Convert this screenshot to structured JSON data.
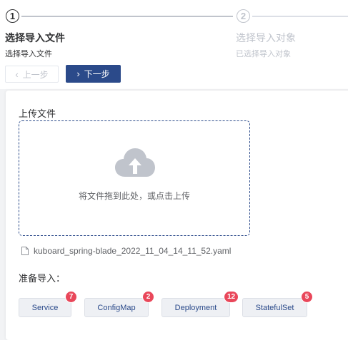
{
  "steps": [
    {
      "number": "1",
      "title": "选择导入文件",
      "description": "选择导入文件"
    },
    {
      "number": "2",
      "title": "选择导入对象",
      "description": "已选择导入对象"
    }
  ],
  "buttons": {
    "prev_label": "上一步",
    "next_label": "下一步"
  },
  "upload": {
    "label": "上传文件",
    "dropzone_text": "将文件拖到此处，或点击上传",
    "file_name": "kuboard_spring-blade_2022_11_04_14_11_52.yaml"
  },
  "prepare": {
    "label": "准备导入：",
    "items": [
      {
        "name": "Service",
        "count": "7"
      },
      {
        "name": "ConfigMap",
        "count": "2"
      },
      {
        "name": "Deployment",
        "count": "12"
      },
      {
        "name": "StatefulSet",
        "count": "5"
      }
    ]
  },
  "colors": {
    "accent": "#2b4a8a",
    "badge": "#e9475a",
    "upload_icon": "#c0c4cc"
  },
  "icons": {
    "prev": "chevron-left-icon",
    "next": "chevron-right-icon",
    "upload": "cloud-upload-icon",
    "file": "document-icon"
  }
}
